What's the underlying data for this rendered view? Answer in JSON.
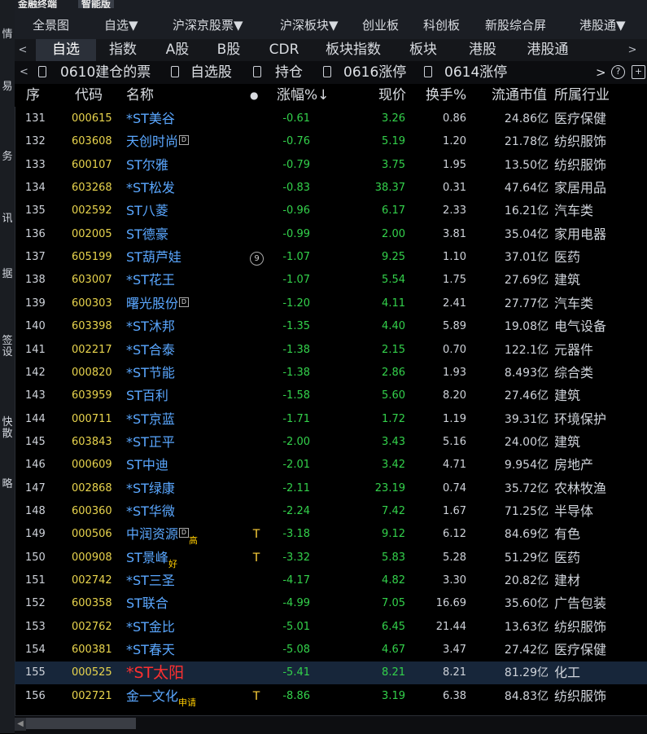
{
  "topstrip": {
    "left": "金融终端",
    "right": "智能版"
  },
  "sidebar": [
    "情",
    "易",
    "务",
    "讯",
    "据",
    "签设",
    "快散",
    "略"
  ],
  "menu": [
    "全景图",
    "自选▼",
    "沪深京股票▼",
    "沪深板块▼",
    "创业板",
    "科创板",
    "新股综合屏",
    "港股通▼"
  ],
  "tabs": {
    "items": [
      "自选",
      "指数",
      "A股",
      "B股",
      "CDR",
      "板块指数",
      "板块",
      "港股",
      "港股通"
    ],
    "active": 0,
    "left_arrow": "<",
    "right_arrow": ">"
  },
  "subtabs": {
    "items": [
      "0610建仓的票",
      "自选股",
      "持仓",
      "0616涨停",
      "0614涨停"
    ],
    "more": ">",
    "help": "?",
    "add": "+"
  },
  "columns": {
    "seq": "序",
    "code": "代码",
    "name": "名称",
    "dot": "●",
    "chg": "涨幅%↓",
    "price": "现价",
    "turnover": "换手%",
    "mcap": "流通市值",
    "industry": "所属行业"
  },
  "rows": [
    {
      "seq": "131",
      "code": "000615",
      "name": "*ST美谷",
      "tag": "",
      "d": false,
      "flag": "",
      "chg": "-0.61",
      "price": "3.26",
      "turn": "0.86",
      "mcap": "24.86亿",
      "ind": "医疗保健"
    },
    {
      "seq": "132",
      "code": "603608",
      "name": "天创时尚",
      "tag": "",
      "d": true,
      "flag": "",
      "chg": "-0.76",
      "price": "5.19",
      "turn": "1.20",
      "mcap": "21.78亿",
      "ind": "纺织服饰"
    },
    {
      "seq": "133",
      "code": "600107",
      "name": "ST尔雅",
      "tag": "",
      "d": false,
      "flag": "",
      "chg": "-0.79",
      "price": "3.75",
      "turn": "1.95",
      "mcap": "13.50亿",
      "ind": "纺织服饰"
    },
    {
      "seq": "134",
      "code": "603268",
      "name": "*ST松发",
      "tag": "",
      "d": false,
      "flag": "",
      "chg": "-0.83",
      "price": "38.37",
      "turn": "0.31",
      "mcap": "47.64亿",
      "ind": "家居用品"
    },
    {
      "seq": "135",
      "code": "002592",
      "name": "ST八菱",
      "tag": "",
      "d": false,
      "flag": "",
      "chg": "-0.96",
      "price": "6.17",
      "turn": "2.33",
      "mcap": "16.21亿",
      "ind": "汽车类"
    },
    {
      "seq": "136",
      "code": "002005",
      "name": "ST德豪",
      "tag": "",
      "d": false,
      "flag": "",
      "chg": "-0.99",
      "price": "2.00",
      "turn": "3.81",
      "mcap": "35.04亿",
      "ind": "家用电器"
    },
    {
      "seq": "137",
      "code": "605199",
      "name": "ST葫芦娃",
      "tag": "",
      "d": false,
      "flag": "9",
      "chg": "-1.07",
      "price": "9.25",
      "turn": "1.10",
      "mcap": "37.01亿",
      "ind": "医药"
    },
    {
      "seq": "138",
      "code": "603007",
      "name": "*ST花王",
      "tag": "",
      "d": false,
      "flag": "",
      "chg": "-1.07",
      "price": "5.54",
      "turn": "1.75",
      "mcap": "27.69亿",
      "ind": "建筑"
    },
    {
      "seq": "139",
      "code": "600303",
      "name": "曙光股份",
      "tag": "",
      "d": true,
      "flag": "",
      "chg": "-1.20",
      "price": "4.11",
      "turn": "2.41",
      "mcap": "27.77亿",
      "ind": "汽车类"
    },
    {
      "seq": "140",
      "code": "603398",
      "name": "*ST沐邦",
      "tag": "",
      "d": false,
      "flag": "",
      "chg": "-1.35",
      "price": "4.40",
      "turn": "5.89",
      "mcap": "19.08亿",
      "ind": "电气设备"
    },
    {
      "seq": "141",
      "code": "002217",
      "name": "*ST合泰",
      "tag": "",
      "d": false,
      "flag": "",
      "chg": "-1.38",
      "price": "2.15",
      "turn": "0.70",
      "mcap": "122.1亿",
      "ind": "元器件"
    },
    {
      "seq": "142",
      "code": "000820",
      "name": "*ST节能",
      "tag": "",
      "d": false,
      "flag": "",
      "chg": "-1.38",
      "price": "2.86",
      "turn": "1.93",
      "mcap": "8.493亿",
      "ind": "综合类"
    },
    {
      "seq": "143",
      "code": "603959",
      "name": "ST百利",
      "tag": "",
      "d": false,
      "flag": "",
      "chg": "-1.58",
      "price": "5.60",
      "turn": "8.20",
      "mcap": "27.46亿",
      "ind": "建筑"
    },
    {
      "seq": "144",
      "code": "000711",
      "name": "*ST京蓝",
      "tag": "",
      "d": false,
      "flag": "",
      "chg": "-1.71",
      "price": "1.72",
      "turn": "1.19",
      "mcap": "39.31亿",
      "ind": "环境保护"
    },
    {
      "seq": "145",
      "code": "603843",
      "name": "*ST正平",
      "tag": "",
      "d": false,
      "flag": "",
      "chg": "-2.00",
      "price": "3.43",
      "turn": "5.16",
      "mcap": "24.00亿",
      "ind": "建筑"
    },
    {
      "seq": "146",
      "code": "000609",
      "name": "ST中迪",
      "tag": "",
      "d": false,
      "flag": "",
      "chg": "-2.01",
      "price": "3.42",
      "turn": "4.71",
      "mcap": "9.954亿",
      "ind": "房地产"
    },
    {
      "seq": "147",
      "code": "002868",
      "name": "*ST绿康",
      "tag": "",
      "d": false,
      "flag": "",
      "chg": "-2.11",
      "price": "23.19",
      "turn": "0.74",
      "mcap": "35.72亿",
      "ind": "农林牧渔"
    },
    {
      "seq": "148",
      "code": "600360",
      "name": "*ST华微",
      "tag": "",
      "d": false,
      "flag": "",
      "chg": "-2.24",
      "price": "7.42",
      "turn": "1.67",
      "mcap": "71.25亿",
      "ind": "半导体"
    },
    {
      "seq": "149",
      "code": "000506",
      "name": "中润资源",
      "tag": "高",
      "d": true,
      "flag": "T",
      "chg": "-3.18",
      "price": "9.12",
      "turn": "6.12",
      "mcap": "84.69亿",
      "ind": "有色"
    },
    {
      "seq": "150",
      "code": "000908",
      "name": "ST景峰",
      "tag": "好",
      "d": false,
      "flag": "T",
      "chg": "-3.32",
      "price": "5.83",
      "turn": "5.28",
      "mcap": "51.29亿",
      "ind": "医药"
    },
    {
      "seq": "151",
      "code": "002742",
      "name": "*ST三圣",
      "tag": "",
      "d": false,
      "flag": "",
      "chg": "-4.17",
      "price": "4.82",
      "turn": "3.30",
      "mcap": "20.82亿",
      "ind": "建材"
    },
    {
      "seq": "152",
      "code": "600358",
      "name": "ST联合",
      "tag": "",
      "d": false,
      "flag": "",
      "chg": "-4.99",
      "price": "7.05",
      "turn": "16.69",
      "mcap": "35.60亿",
      "ind": "广告包装"
    },
    {
      "seq": "153",
      "code": "002762",
      "name": "*ST金比",
      "tag": "",
      "d": false,
      "flag": "",
      "chg": "-5.01",
      "price": "6.45",
      "turn": "21.44",
      "mcap": "13.63亿",
      "ind": "纺织服饰"
    },
    {
      "seq": "154",
      "code": "600381",
      "name": "*ST春天",
      "tag": "",
      "d": false,
      "flag": "",
      "chg": "-5.08",
      "price": "4.67",
      "turn": "3.47",
      "mcap": "27.42亿",
      "ind": "医疗保健"
    },
    {
      "seq": "155",
      "code": "000525",
      "name": "*ST太阳",
      "tag": "",
      "d": false,
      "flag": "",
      "chg": "-5.41",
      "price": "8.21",
      "turn": "8.21",
      "mcap": "81.29亿",
      "ind": "化工",
      "selected": true
    },
    {
      "seq": "156",
      "code": "002721",
      "name": "金一文化",
      "tag": "申请",
      "d": false,
      "flag": "T",
      "chg": "-8.86",
      "price": "3.19",
      "turn": "6.38",
      "mcap": "84.83亿",
      "ind": "纺织服饰"
    }
  ],
  "scroll": {
    "left_btn": "◀"
  }
}
